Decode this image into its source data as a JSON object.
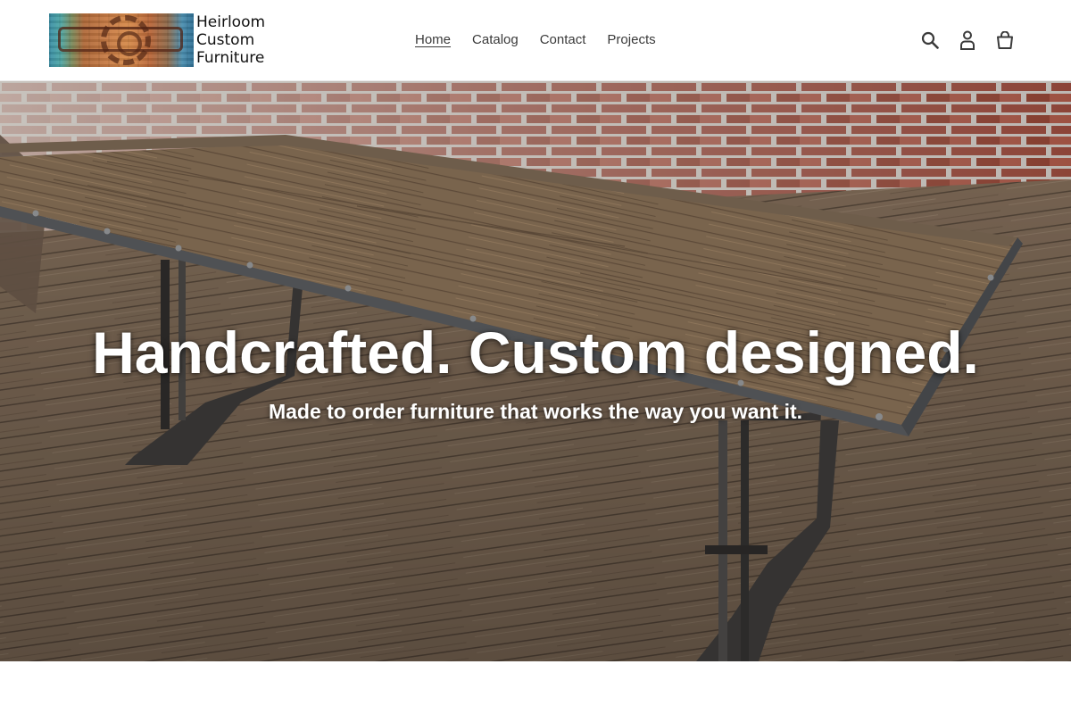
{
  "header": {
    "logo": {
      "image_text": "heirloom",
      "text_line1": "Heirloom",
      "text_line2": "Custom",
      "text_line3": "Furniture"
    },
    "nav": [
      {
        "label": "Home",
        "active": true
      },
      {
        "label": "Catalog",
        "active": false
      },
      {
        "label": "Contact",
        "active": false
      },
      {
        "label": "Projects",
        "active": false
      }
    ],
    "icons": [
      "search-icon",
      "account-icon",
      "cart-icon"
    ]
  },
  "hero": {
    "title": "Handcrafted. Custom designed.",
    "subtitle": "Made to order furniture that works the way you want it."
  },
  "colors": {
    "text": "#3a3a3a",
    "hero_text": "#ffffff",
    "brick": "#9a4a3c",
    "wood": "#7b6650",
    "steel": "#5b5d60"
  }
}
